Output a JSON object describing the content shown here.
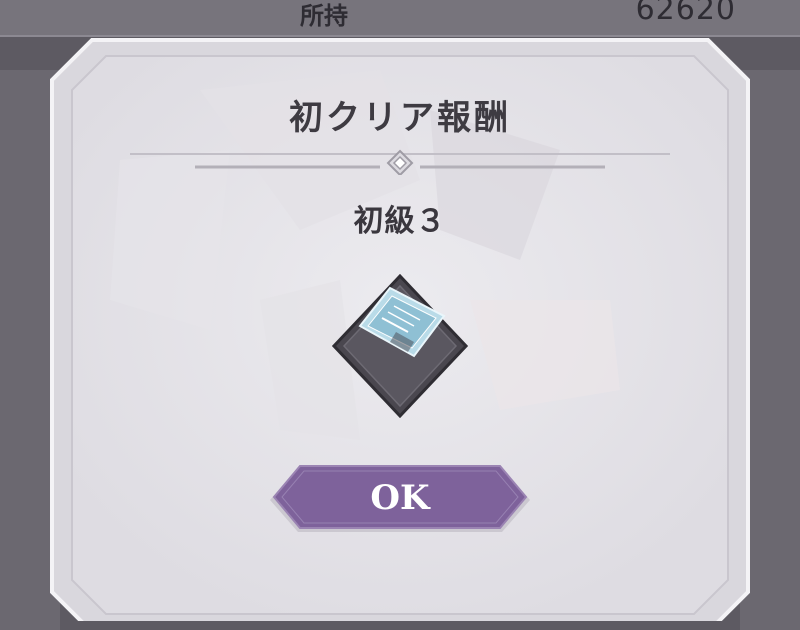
{
  "background": {
    "owned_label": "所持",
    "owned_value": "62620"
  },
  "dialog": {
    "title": "初クリア報酬",
    "reward_name": "初級３",
    "reward_icon": "ticket-icon",
    "ok_label": "OK"
  },
  "colors": {
    "panel": "#e9e7ec",
    "panel_border": "#f7f6f9",
    "button": "#7e629b",
    "frame": "#3f3c44"
  }
}
